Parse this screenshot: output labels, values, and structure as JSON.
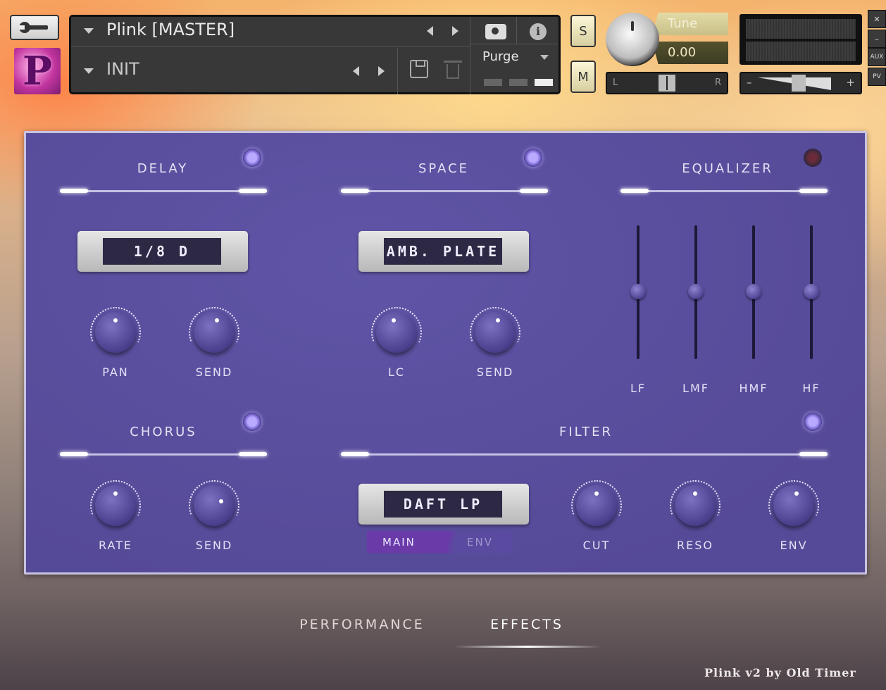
{
  "header": {
    "logo_letter": "P",
    "instrument_name": "Plink [MASTER]",
    "preset_name": "INIT",
    "purge_label": "Purge",
    "solo_label": "S",
    "mute_label": "M",
    "tune_label": "Tune",
    "tune_value": "0.00",
    "pan_left": "L",
    "pan_right": "R",
    "vol_minus": "–",
    "vol_plus": "+",
    "side_close": "✕",
    "side_minimize": "–",
    "side_aux": "AUX",
    "side_pv": "PV"
  },
  "sections": {
    "delay": {
      "title": "DELAY",
      "display": "1/8 D",
      "knobs": [
        "PAN",
        "SEND"
      ],
      "enabled": true
    },
    "space": {
      "title": "SPACE",
      "display": "AMB. PLATE",
      "knobs": [
        "LC",
        "SEND"
      ],
      "enabled": true
    },
    "equalizer": {
      "title": "EQUALIZER",
      "bands": [
        "LF",
        "LMF",
        "HMF",
        "HF"
      ],
      "enabled": false
    },
    "chorus": {
      "title": "CHORUS",
      "knobs": [
        "RATE",
        "SEND"
      ],
      "enabled": true
    },
    "filter": {
      "title": "FILTER",
      "display": "DAFT LP",
      "tabs": [
        "MAIN",
        "ENV"
      ],
      "knobs": [
        "CUT",
        "RESO",
        "ENV"
      ],
      "enabled": true
    }
  },
  "pages": {
    "performance": "PERFORMANCE",
    "effects": "EFFECTS",
    "active": "EFFECTS"
  },
  "footer": "Plink v2 by Old Timer",
  "colors": {
    "panel": "#5b50a0",
    "led_on": "#b9a9ff",
    "active_tab": "#6a3aa8"
  }
}
